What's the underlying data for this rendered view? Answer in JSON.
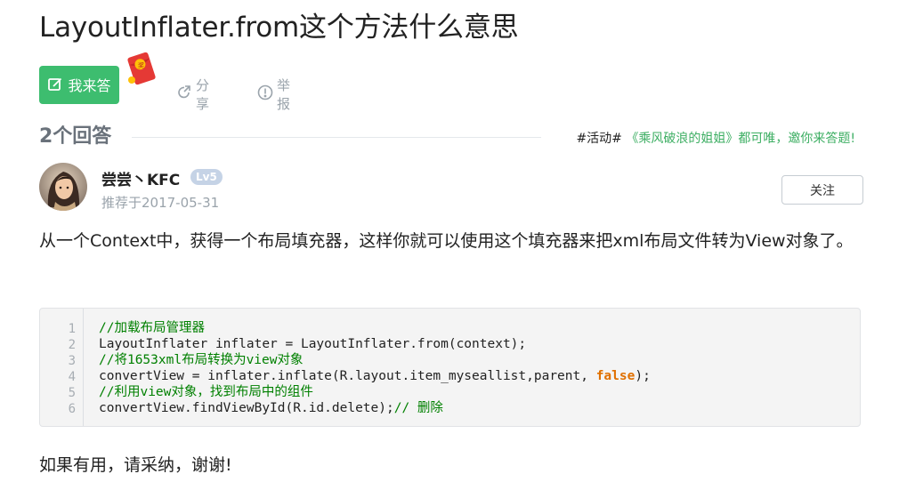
{
  "question": {
    "title": "LayoutInflater.from这个方法什么意思"
  },
  "actions": {
    "answer_label": "我来答",
    "share_label": "分享",
    "report_label": "举报",
    "redpacket_text": "奖"
  },
  "answers_header": {
    "count_text": "2个回答",
    "activity_tag": "#活动#",
    "activity_text": "《乘风破浪的姐姐》都可唯，邀你来答题!"
  },
  "answer": {
    "author_name": "尝尝丶KFC",
    "level": "Lv5",
    "recommend_text": "推荐于2017-05-31",
    "follow_label": "关注",
    "body_text": "从一个Context中，获得一个布局填充器，这样你就可以使用这个填充器来把xml布局文件转为View对象了。",
    "code": {
      "line_numbers": [
        "1",
        "2",
        "3",
        "4",
        "5",
        "6"
      ],
      "lines": [
        {
          "type": "comment",
          "text": "//加载布局管理器"
        },
        {
          "type": "code",
          "text": "LayoutInflater inflater = LayoutInflater.from(context);"
        },
        {
          "type": "comment",
          "text": "//将1653xml布局转换为view对象"
        },
        {
          "type": "mixed",
          "before": "convertView = inflater.inflate(R.layout.item_myseallist,parent, ",
          "keyword": "false",
          "after": ");"
        },
        {
          "type": "comment",
          "text": "//利用view对象，找到布局中的组件"
        },
        {
          "type": "mixed2",
          "before": "convertView.findViewById(R.id.delete);",
          "comment": "// 删除"
        }
      ]
    },
    "closing_text": "如果有用，请采纳，谢谢!"
  },
  "colors": {
    "primary_green": "#3dbd6f",
    "muted_gray": "#9aa3ab",
    "keyword_orange": "#e07000",
    "comment_green": "#008000"
  },
  "icons": {
    "answer": "edit-icon",
    "share": "share-icon",
    "report": "report-icon",
    "redpacket": "red-packet-icon"
  }
}
